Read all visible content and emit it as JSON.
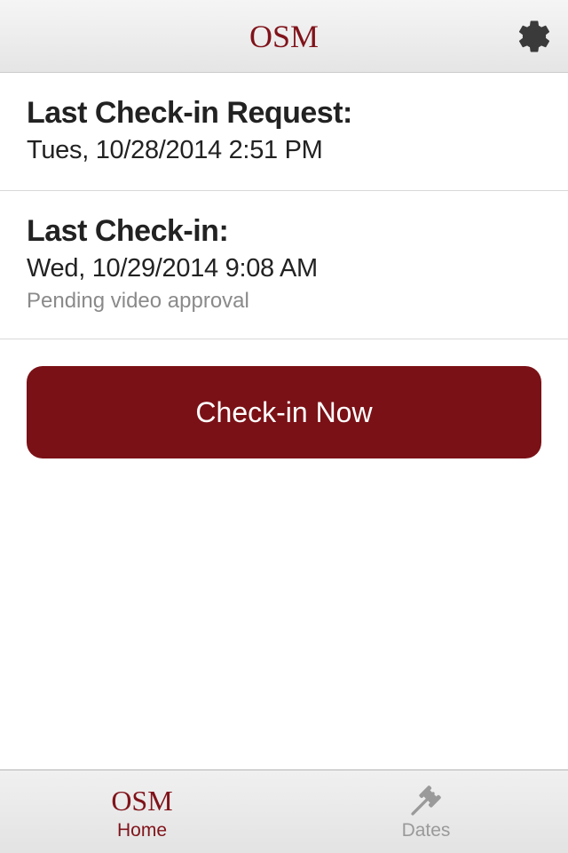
{
  "header": {
    "title": "OSM"
  },
  "colors": {
    "brand": "#80131a",
    "button_bg": "#7a1116"
  },
  "sections": {
    "last_request": {
      "label": "Last Check-in Request:",
      "value": "Tues, 10/28/2014 2:51 PM"
    },
    "last_checkin": {
      "label": "Last Check-in:",
      "value": "Wed, 10/29/2014 9:08 AM",
      "status": "Pending video approval"
    }
  },
  "actions": {
    "checkin_label": "Check-in Now"
  },
  "tabs": {
    "home": {
      "icon_text": "OSM",
      "label": "Home"
    },
    "dates": {
      "label": "Dates"
    }
  },
  "icons": {
    "settings": "gear-icon",
    "dates": "gavel-icon"
  }
}
